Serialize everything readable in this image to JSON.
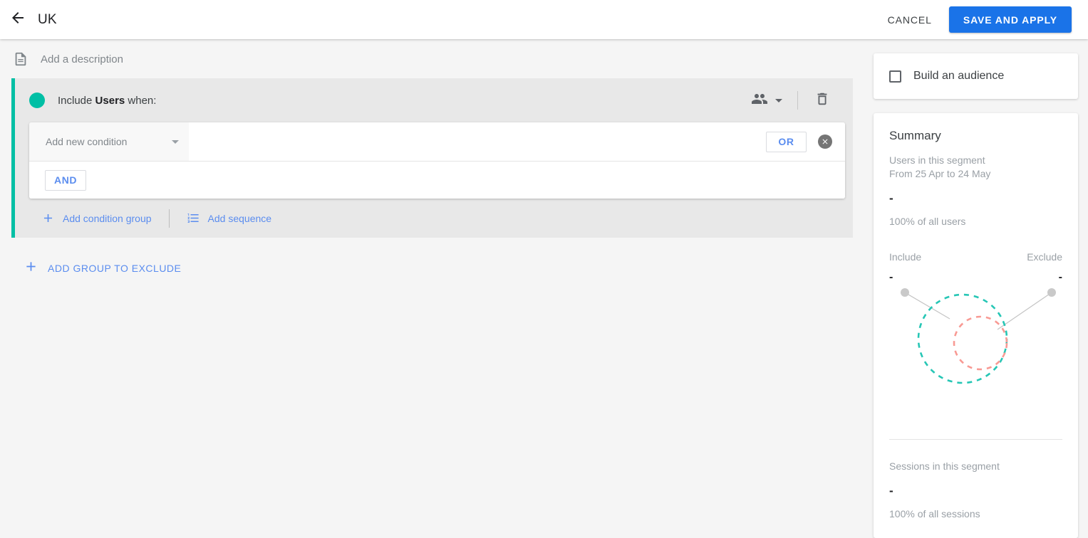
{
  "header": {
    "back_icon": "arrow-back-icon",
    "title": "UK",
    "cancel_label": "CANCEL",
    "save_label": "SAVE AND APPLY",
    "accent_blue": "#1a73e8"
  },
  "description": {
    "icon": "description-icon",
    "placeholder": "Add a description"
  },
  "segment_group": {
    "accent_teal": "#00bfa5",
    "title_prefix": "Include ",
    "title_scope": "Users",
    "title_suffix": " when:",
    "scope_icon": "people-icon",
    "delete_icon": "trash-icon",
    "condition": {
      "select_value": "Add new condition",
      "or_label": "OR",
      "remove_icon": "close-circle-icon",
      "and_label": "AND"
    },
    "footer": {
      "add_condition_group": "Add condition group",
      "add_condition_group_icon": "plus-icon",
      "add_sequence": "Add sequence",
      "add_sequence_icon": "ordered-list-icon"
    }
  },
  "exclude": {
    "icon": "plus-icon",
    "label": "ADD GROUP TO EXCLUDE"
  },
  "audience": {
    "label": "Build an audience",
    "checkbox_icon": "checkbox-unchecked-icon",
    "checked": false
  },
  "summary": {
    "title": "Summary",
    "users_label": "Users in this segment",
    "date_range": "From 25 Apr to 24 May",
    "users_value": "-",
    "users_percent": "100% of all users",
    "include_label": "Include",
    "exclude_label": "Exclude",
    "include_value": "-",
    "exclude_value": "-",
    "venn": {
      "include_color": "#26c6b5",
      "exclude_color": "#f89a94",
      "leader_color": "#c4c4c4"
    },
    "sessions_label": "Sessions in this segment",
    "sessions_value": "-",
    "sessions_percent": "100% of all sessions"
  }
}
